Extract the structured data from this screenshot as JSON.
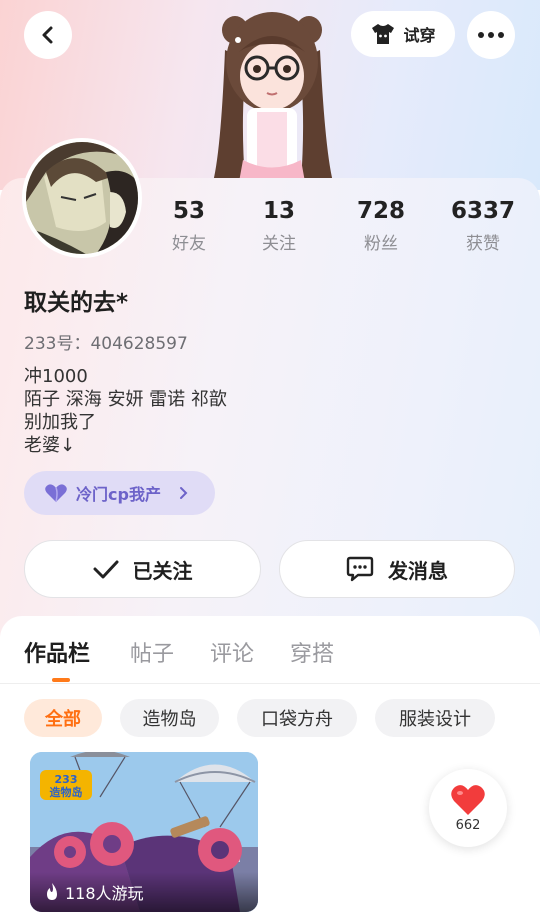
{
  "header": {
    "back_icon": "chevron-left-icon",
    "tryon_label": "试穿",
    "tryon_icon": "tshirt-icon",
    "more_icon": "more-dots-icon"
  },
  "stats": [
    {
      "value": "53",
      "label": "好友"
    },
    {
      "value": "13",
      "label": "关注"
    },
    {
      "value": "728",
      "label": "粉丝"
    },
    {
      "value": "6337",
      "label": "获赞"
    }
  ],
  "profile": {
    "username": "取关的去*",
    "uid": "233号：404628597",
    "bio": [
      "冲1000",
      "陌子 深海 安妍 雷诺 祁歆",
      "别加我了",
      "老婆↓"
    ],
    "tag": {
      "label": "冷门cp我产",
      "icon": "heart-icon"
    }
  },
  "actions": {
    "follow_label": "已关注",
    "message_label": "发消息"
  },
  "tabs": [
    {
      "label": "作品栏",
      "active": true
    },
    {
      "label": "帖子",
      "active": false
    },
    {
      "label": "评论",
      "active": false
    },
    {
      "label": "穿搭",
      "active": false
    }
  ],
  "filters": [
    {
      "label": "全部",
      "active": true
    },
    {
      "label": "造物岛",
      "active": false
    },
    {
      "label": "口袋方舟",
      "active": false
    },
    {
      "label": "服装设计",
      "active": false
    }
  ],
  "works": [
    {
      "players": "118人游玩",
      "logo_text": "233 造物岛"
    }
  ],
  "like": {
    "count": "662"
  },
  "colors": {
    "accent": "#ff7a1a",
    "cp_chip_bg": "#e0dcf6",
    "cp_chip_text": "#6d63c9",
    "like_heart": "#f23c3c"
  }
}
